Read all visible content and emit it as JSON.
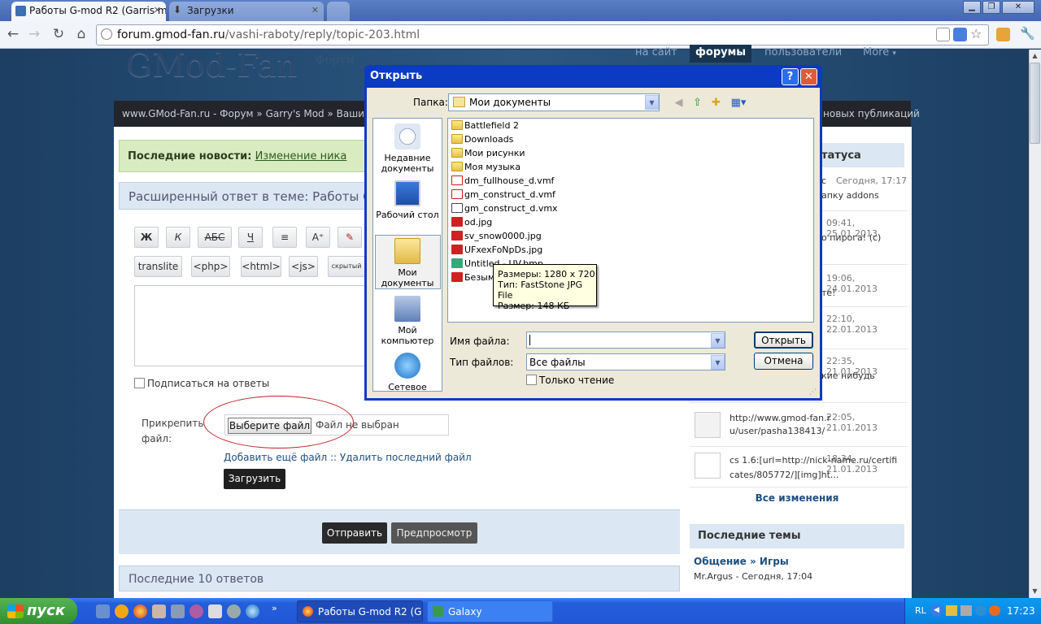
{
  "browser": {
    "tabs": [
      {
        "label": "Работы G-mod R2 (Garris man",
        "active": true
      },
      {
        "label": "Загрузки",
        "active": false
      }
    ],
    "url_domain": "forum.gmod-fan.ru",
    "url_path": "/vashi-raboty/reply/topic-203.html"
  },
  "site": {
    "logo": "GMod-Fan",
    "logo_sub": "Форум",
    "nav": [
      "на сайт",
      "форумы",
      "пользователи",
      "More"
    ],
    "breadcrumbs": "www.GMod-Fan.ru - Форум » Garry's Mod » Ваши работы » Т",
    "breadcrumbs_right": "новых публикаций",
    "news_label": "Последние новости:",
    "news_link": "Изменение ника",
    "reply_title": "Расширенный ответ в теме: Работы G-mo",
    "editor_row1": [
      "Ж",
      "К",
      "АБС",
      "Ч",
      "≡",
      "A⁺",
      "✎"
    ],
    "editor_row2": [
      "translite",
      "<php>",
      "<html>",
      "<js>",
      "скрытый"
    ],
    "subscribe_label": "Подписаться на ответы",
    "attach_label": "Прикрепить файл:",
    "choose_file": "Выберите файл",
    "no_file": "Файл не выбран",
    "add_links": "Добавить ещё файл :: Удалить последний файл",
    "upload": "Загрузить",
    "send": "Отправить",
    "preview": "Предпросмотр",
    "last10": "Последние 10 ответов"
  },
  "sidebar": {
    "header": "татуса",
    "rows": [
      {
        "time": "Сегодня, 17:17",
        "pre": "с",
        "text": "апку addons"
      },
      {
        "time": "09:41, 25.01.2013",
        "text": "о пирога! (с)"
      },
      {
        "time": "19:06, 24.01.2013",
        "text": "те!"
      },
      {
        "time": "22:10, 22.01.2013",
        "text": ""
      },
      {
        "time": "22:35, 21.01.2013",
        "text": "кие нибудь"
      },
      {
        "time": "22:05, 21.01.2013",
        "text": "http://www.gmod-fan.ru/user/pasha138413/"
      },
      {
        "time": "18:34, 21.01.2013",
        "text": "cs 1.6:[url=http://nick-name.ru/certificates/805772/][img]ht..."
      }
    ],
    "all_changes": "Все изменения",
    "topics_header": "Последние темы",
    "topic1_title": "Общение » Игры",
    "topic1_meta": "Mr.Argus  - Сегодня, 17:04"
  },
  "dialog": {
    "title": "Открыть",
    "folder_label": "Папка:",
    "folder_value": "Мои документы",
    "places": [
      {
        "label": "Недавние документы",
        "icon": "recent-docs-icon"
      },
      {
        "label": "Рабочий стол",
        "icon": "desktop-icon"
      },
      {
        "label": "Мои документы",
        "icon": "my-documents-icon"
      },
      {
        "label": "Мой компьютер",
        "icon": "my-computer-icon"
      },
      {
        "label": "Сетевое",
        "icon": "network-icon"
      }
    ],
    "files": [
      {
        "name": "Battlefield 2",
        "type": "folder"
      },
      {
        "name": "Downloads",
        "type": "folder"
      },
      {
        "name": "Мои рисунки",
        "type": "folder"
      },
      {
        "name": "Моя музыка",
        "type": "folder"
      },
      {
        "name": "dm_fullhouse_d.vmf",
        "type": "vmf"
      },
      {
        "name": "gm_construct_d.vmf",
        "type": "vmf"
      },
      {
        "name": "gm_construct_d.vmx",
        "type": "vmx"
      },
      {
        "name": "od.jpg",
        "type": "jpg"
      },
      {
        "name": "sv_snow0000.jpg",
        "type": "jpg"
      },
      {
        "name": "UFxexFoNpDs.jpg",
        "type": "jpg"
      },
      {
        "name": "Untitled - UV.bmp",
        "type": "bmp"
      },
      {
        "name": "Безымя",
        "type": "jpg"
      }
    ],
    "tooltip": [
      "Размеры: 1280 x 720",
      "Тип: FastStone JPG File",
      "Размер: 148 КБ"
    ],
    "filename_label": "Имя файла:",
    "filename_value": "",
    "filetype_label": "Тип файлов:",
    "filetype_value": "Все файлы",
    "readonly_label": "Только чтение",
    "open_btn": "Открыть",
    "cancel_btn": "Отмена"
  },
  "taskbar": {
    "start": "пуск",
    "tasks": [
      "Работы G-mod R2 (G...",
      "Galaxy"
    ],
    "lang": "RL",
    "clock": "17:23"
  },
  "colors": {
    "xp_blue": "#0a3bc2",
    "news_green": "#d9ebc1",
    "accent_red": "#c0202a"
  }
}
